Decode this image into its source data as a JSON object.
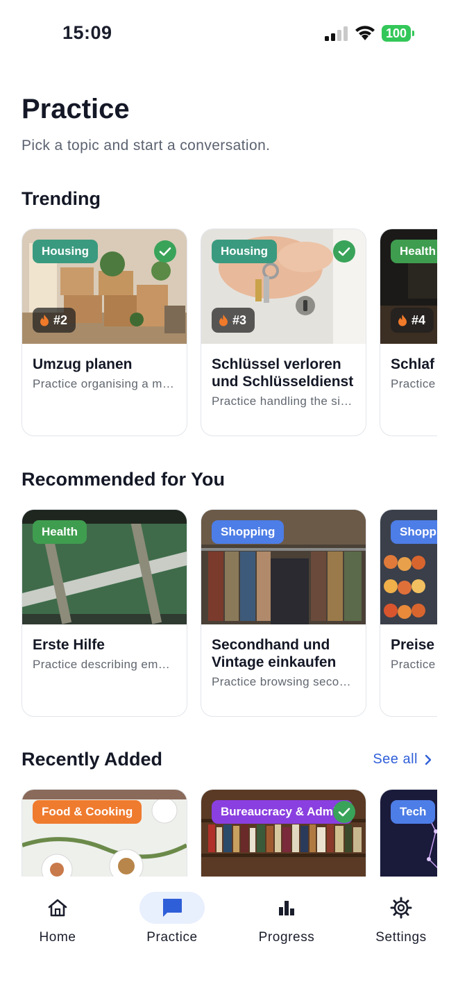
{
  "status": {
    "time": "15:09",
    "battery": "100"
  },
  "header": {
    "title": "Practice",
    "subtitle": "Pick a topic and start a conversation."
  },
  "sections": {
    "trending": {
      "title": "Trending",
      "cards": [
        {
          "tag": "Housing",
          "tag_color": "#3a9a7f",
          "rank": "#2",
          "completed": true,
          "title": "Umzug planen",
          "desc": "Practice organising a move",
          "image": "moving-boxes"
        },
        {
          "tag": "Housing",
          "tag_color": "#3a9a7f",
          "rank": "#3",
          "completed": true,
          "title": "Schlüssel verloren und Schlüsseldienst",
          "desc": "Practice handling the situation",
          "image": "keys-in-hand"
        },
        {
          "tag": "Health",
          "tag_color": "#3f9d4f",
          "rank": "#4",
          "completed": false,
          "title": "Schlaf und Erholung",
          "desc": "Practice talking about sleep",
          "image": "dark-bedroom"
        }
      ]
    },
    "recommended": {
      "title": "Recommended for You",
      "cards": [
        {
          "tag": "Health",
          "tag_color": "#3f9d4f",
          "title": "Erste Hilfe",
          "desc": "Practice describing emergencies",
          "image": "first-aid-bag"
        },
        {
          "tag": "Shopping",
          "tag_color": "#4d7de6",
          "title": "Secondhand und Vintage einkaufen",
          "desc": "Practice browsing secondhand shops",
          "image": "clothing-rack"
        },
        {
          "tag": "Shopping",
          "tag_color": "#4d7de6",
          "title": "Preise",
          "desc": "Practice asking about prices",
          "image": "fruit-stand"
        }
      ]
    },
    "recent": {
      "title": "Recently Added",
      "see_all": "See all",
      "cards": [
        {
          "tag": "Food & Cooking",
          "tag_color": "#ef7b2f",
          "completed": false,
          "image": "dinner-table"
        },
        {
          "tag": "Bureaucracy & Admin",
          "tag_color": "#8a3fe0",
          "completed": true,
          "image": "bookshelves"
        },
        {
          "tag": "Tech",
          "tag_color": "#4d7de6",
          "completed": false,
          "image": "network-graphic"
        }
      ]
    }
  },
  "nav": {
    "items": [
      {
        "label": "Home",
        "icon": "home-icon"
      },
      {
        "label": "Practice",
        "icon": "chat-bubble-icon",
        "active": true
      },
      {
        "label": "Progress",
        "icon": "bar-chart-icon"
      },
      {
        "label": "Settings",
        "icon": "gear-icon"
      }
    ],
    "active_color": "#2f5fd8"
  }
}
